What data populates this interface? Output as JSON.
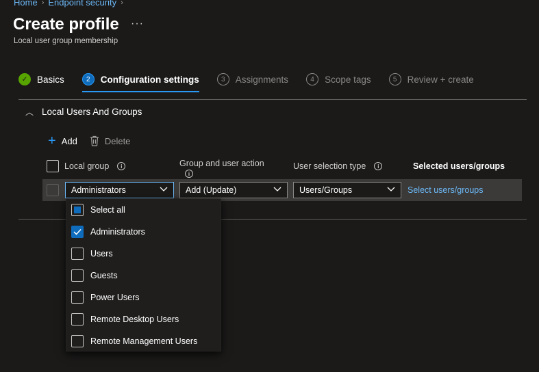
{
  "breadcrumb": [
    "Home",
    "Endpoint security"
  ],
  "page": {
    "title": "Create profile",
    "more": "···",
    "subtitle": "Local user group membership"
  },
  "steps": [
    {
      "num": "✓",
      "label": "Basics",
      "state": "done"
    },
    {
      "num": "2",
      "label": "Configuration settings",
      "state": "active"
    },
    {
      "num": "3",
      "label": "Assignments",
      "state": "pending"
    },
    {
      "num": "4",
      "label": "Scope tags",
      "state": "pending"
    },
    {
      "num": "5",
      "label": "Review + create",
      "state": "pending"
    }
  ],
  "section": {
    "title": "Local Users And Groups",
    "caret": "︿"
  },
  "toolbar": {
    "add_label": "Add",
    "delete_label": "Delete"
  },
  "table": {
    "headers": {
      "local_group": "Local group",
      "action": "Group and user action",
      "selection_type": "User selection type",
      "selected": "Selected users/groups"
    },
    "row": {
      "local_group": "Administrators",
      "action": "Add (Update)",
      "selection_type": "Users/Groups",
      "selected_link": "Select users/groups"
    }
  },
  "dropdown": {
    "options": [
      {
        "label": "Select all",
        "state": "partial"
      },
      {
        "label": "Administrators",
        "state": "checked"
      },
      {
        "label": "Users",
        "state": "unchecked"
      },
      {
        "label": "Guests",
        "state": "unchecked"
      },
      {
        "label": "Power Users",
        "state": "unchecked"
      },
      {
        "label": "Remote Desktop Users",
        "state": "unchecked"
      },
      {
        "label": "Remote Management Users",
        "state": "unchecked"
      }
    ]
  },
  "colors": {
    "accent": "#2899f5",
    "link": "#6cb8f6",
    "success": "#57a300",
    "background": "#1b1a19"
  }
}
